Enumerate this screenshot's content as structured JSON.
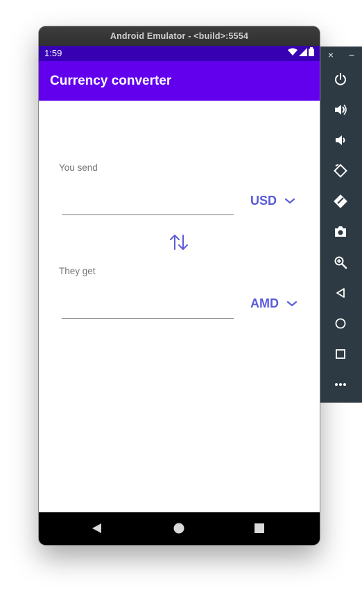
{
  "window": {
    "title": "Android Emulator - <build>:5554"
  },
  "status_bar": {
    "time": "1:59"
  },
  "app_bar": {
    "title": "Currency converter"
  },
  "send": {
    "label": "You send",
    "value": "",
    "currency": "USD"
  },
  "get": {
    "label": "They get",
    "value": "",
    "currency": "AMD"
  },
  "toolbar": {
    "close": "×",
    "minimize": "−",
    "buttons": [
      "power-icon",
      "volume-up-icon",
      "volume-down-icon",
      "rotate-left-icon",
      "rotate-right-icon",
      "camera-icon",
      "zoom-icon",
      "back-icon",
      "home-icon",
      "overview-icon",
      "more-icon"
    ]
  },
  "colors": {
    "status_bar": "#3700b3",
    "app_bar": "#6200ee",
    "accent": "#5b5bd9",
    "toolbar": "#2e3a43"
  }
}
